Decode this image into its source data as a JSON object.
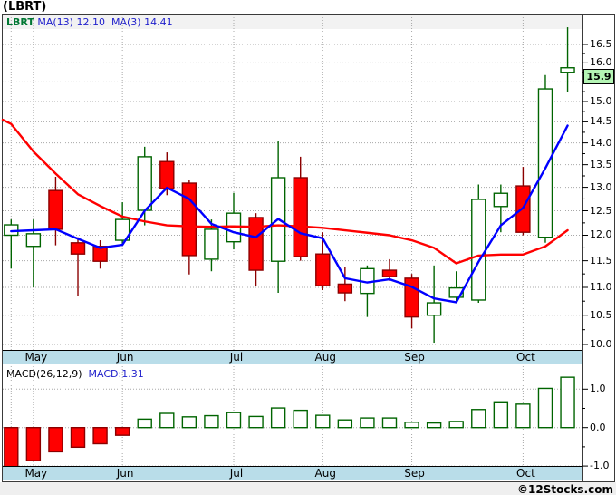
{
  "header": {
    "title": "(LBRT)"
  },
  "price_panel": {
    "legend": {
      "symbol": "LBRT",
      "ma13_label": "MA(13)",
      "ma13_value": "12.10",
      "ma3_label": "MA(3)",
      "ma3_value": "14.41"
    },
    "price_badge": "15.9",
    "axis_tick_step": 0.5
  },
  "macd_panel": {
    "legend_left": "MACD(26,12,9)",
    "legend_right": "MACD:1.31",
    "axis_labels": [
      1.0,
      0.0,
      -1.0
    ]
  },
  "footer": {
    "copyright": "©12Stocks.com"
  },
  "colors": {
    "up_stroke": "#006400",
    "up_fill": "#ffffff",
    "down_stroke": "#8b0000",
    "down_fill": "#ff0000",
    "ma13_line": "#ff0000",
    "ma3_line": "#0000ff",
    "grid": "#a8a8a8",
    "month_bar": "#b9dde9",
    "badge_bg": "#b4f4b4",
    "legend_blue": "#2222cc",
    "legend_green": "#007733"
  },
  "chart_data": [
    {
      "type": "candlestick",
      "title": "LBRT weekly candlestick with MA(13) and MA(3)",
      "yscale": "log",
      "ylim": [
        10.0,
        16.5
      ],
      "y_axis_labels": [
        "16.5",
        "16.0",
        "15.5",
        "15.0",
        "14.5",
        "14.0",
        "13.5",
        "13.0",
        "12.5",
        "12.0",
        "11.5",
        "11.0",
        "10.5",
        "10.0"
      ],
      "months": [
        {
          "label": "May",
          "candle_index": 1
        },
        {
          "label": "Jun",
          "candle_index": 5
        },
        {
          "label": "Jul",
          "candle_index": 10
        },
        {
          "label": "Aug",
          "candle_index": 14
        },
        {
          "label": "Sep",
          "candle_index": 18
        },
        {
          "label": "Oct",
          "candle_index": 23
        }
      ],
      "extra_grid_candle_index": 0,
      "ohlc": [
        {
          "o": 12.0,
          "h": 12.32,
          "l": 11.35,
          "c": 12.21
        },
        {
          "o": 11.78,
          "h": 12.32,
          "l": 11.0,
          "c": 12.03
        },
        {
          "o": 12.93,
          "h": 13.23,
          "l": 11.8,
          "c": 12.12
        },
        {
          "o": 11.85,
          "h": 11.96,
          "l": 10.84,
          "c": 11.63
        },
        {
          "o": 11.78,
          "h": 11.9,
          "l": 11.35,
          "c": 11.49
        },
        {
          "o": 11.9,
          "h": 12.68,
          "l": 11.8,
          "c": 12.32
        },
        {
          "o": 12.51,
          "h": 13.91,
          "l": 12.2,
          "c": 13.68
        },
        {
          "o": 13.57,
          "h": 13.78,
          "l": 12.83,
          "c": 12.97
        },
        {
          "o": 13.09,
          "h": 13.15,
          "l": 11.24,
          "c": 11.6
        },
        {
          "o": 11.53,
          "h": 12.32,
          "l": 11.3,
          "c": 12.12
        },
        {
          "o": 11.87,
          "h": 12.88,
          "l": 11.72,
          "c": 12.45
        },
        {
          "o": 12.36,
          "h": 12.45,
          "l": 11.03,
          "c": 11.32
        },
        {
          "o": 11.49,
          "h": 14.04,
          "l": 10.9,
          "c": 13.21
        },
        {
          "o": 13.21,
          "h": 13.68,
          "l": 11.5,
          "c": 11.58
        },
        {
          "o": 11.63,
          "h": 12.06,
          "l": 10.95,
          "c": 11.03
        },
        {
          "o": 11.06,
          "h": 11.38,
          "l": 10.75,
          "c": 10.9
        },
        {
          "o": 10.89,
          "h": 11.41,
          "l": 10.47,
          "c": 11.35
        },
        {
          "o": 11.32,
          "h": 11.53,
          "l": 11.12,
          "c": 11.2
        },
        {
          "o": 11.17,
          "h": 11.25,
          "l": 10.27,
          "c": 10.47
        },
        {
          "o": 10.5,
          "h": 11.41,
          "l": 10.03,
          "c": 10.72
        },
        {
          "o": 10.82,
          "h": 11.3,
          "l": 10.75,
          "c": 10.99
        },
        {
          "o": 10.77,
          "h": 13.06,
          "l": 10.72,
          "c": 12.74
        },
        {
          "o": 12.59,
          "h": 13.06,
          "l": 12.06,
          "c": 12.87
        },
        {
          "o": 13.03,
          "h": 13.45,
          "l": 12.0,
          "c": 12.06
        },
        {
          "o": 11.96,
          "h": 15.68,
          "l": 11.85,
          "c": 15.32
        },
        {
          "o": 15.75,
          "h": 16.98,
          "l": 15.25,
          "c": 15.87
        }
      ],
      "overlays": [
        {
          "name": "MA(13)",
          "values": [
            14.45,
            13.8,
            13.3,
            12.85,
            12.6,
            12.38,
            12.28,
            12.2,
            12.18,
            12.17,
            12.18,
            12.17,
            12.2,
            12.18,
            12.15,
            12.1,
            12.05,
            12.0,
            11.9,
            11.75,
            11.45,
            11.6,
            11.62,
            11.62,
            11.78,
            12.1
          ]
        },
        {
          "name": "MA(3)",
          "values": [
            12.08,
            12.1,
            12.12,
            11.93,
            11.75,
            11.81,
            12.5,
            12.99,
            12.75,
            12.23,
            12.06,
            11.96,
            12.33,
            12.04,
            11.94,
            11.17,
            11.09,
            11.15,
            11.01,
            10.8,
            10.73,
            11.48,
            12.2,
            12.56,
            13.42,
            14.41
          ]
        }
      ],
      "last_price": 15.9
    },
    {
      "type": "bar",
      "title": "MACD(26,12,9) histogram",
      "ylim": [
        -1.3,
        1.5
      ],
      "y_axis_labels": [
        "1.0",
        "0.0",
        "-1.0"
      ],
      "values": [
        -1.02,
        -0.86,
        -0.63,
        -0.51,
        -0.42,
        -0.2,
        0.22,
        0.37,
        0.28,
        0.31,
        0.39,
        0.29,
        0.51,
        0.45,
        0.32,
        0.2,
        0.25,
        0.25,
        0.14,
        0.12,
        0.16,
        0.47,
        0.67,
        0.61,
        1.02,
        1.31
      ],
      "last_value": 1.31
    }
  ]
}
